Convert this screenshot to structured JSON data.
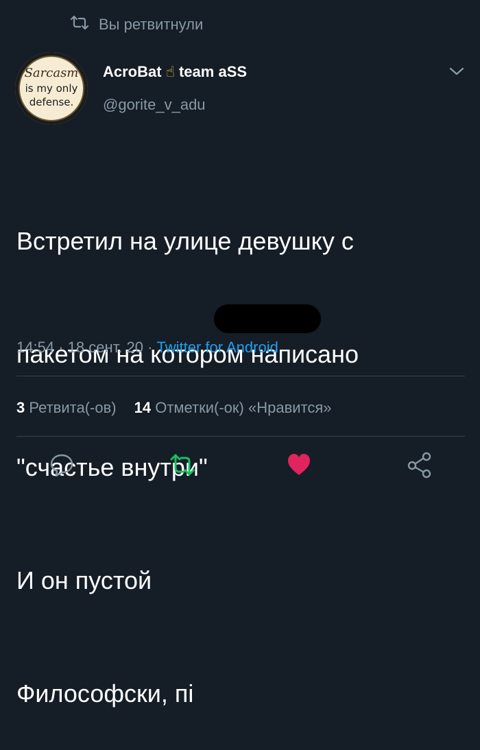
{
  "retweet_context": {
    "icon": "retweet-icon",
    "text": "Вы ретвитнули"
  },
  "author": {
    "name": "AcroBat",
    "emoji": "☝",
    "name_suffix": "team aSS",
    "handle": "@gorite_v_adu",
    "avatar_text": [
      "Sarcasm",
      "is my only",
      "defense."
    ]
  },
  "tweet": {
    "lines": [
      "Встретил на улице девушку с",
      "пакетом на котором написано",
      "\"счастье внутри\"",
      "И он пустой",
      "Философски, пі"
    ]
  },
  "meta": {
    "time": "14:54",
    "separator": "·",
    "date": "18 сент. 20",
    "source": "Twitter for Android"
  },
  "stats": {
    "retweets_count": "3",
    "retweets_label": "Ретвита(-ов)",
    "likes_count": "14",
    "likes_label": "Отметки(-ок) «Нравится»"
  },
  "colors": {
    "background": "#151d26",
    "secondary_text": "#8899a6",
    "link": "#1da1f2",
    "retweet_active": "#17bf63",
    "like_active": "#e0245e"
  },
  "actions": [
    "reply-icon",
    "retweet-icon",
    "like-icon",
    "share-icon"
  ]
}
